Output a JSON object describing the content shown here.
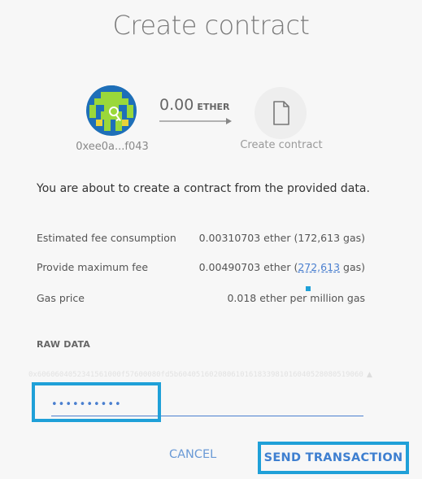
{
  "window": {
    "title": "Create contract"
  },
  "from": {
    "address": "0xee0a...f043",
    "identicon": "identicon-avatar"
  },
  "transfer": {
    "amount": "0.00",
    "unit": "ETHER",
    "arrow_icon": "arrow-right-icon"
  },
  "to": {
    "label": "Create contract",
    "icon": "document-icon"
  },
  "notice": "You are about to create a contract from the provided data.",
  "fees": {
    "estimated": {
      "label": "Estimated fee consumption",
      "value": "0.00310703 ether (172,613 gas)"
    },
    "maximum": {
      "label": "Provide maximum fee",
      "value_prefix": "0.00490703 ether (",
      "gas_link": "272,613",
      "value_suffix": " gas)"
    },
    "gas_price": {
      "label": "Gas price",
      "value": "0.018 ether per million gas"
    }
  },
  "raw": {
    "label": "RAW DATA",
    "value": "0x6060604052341561000f57600080fd5b6040516020806101618339810160405280805190602001909190505b"
  },
  "password": {
    "value": "••••••••••"
  },
  "buttons": {
    "cancel": "CANCEL",
    "send": "SEND TRANSACTION"
  },
  "colors": {
    "accent": "#4a7fcf",
    "focus": "#1fa0d8",
    "background": "#f7f7f7"
  }
}
